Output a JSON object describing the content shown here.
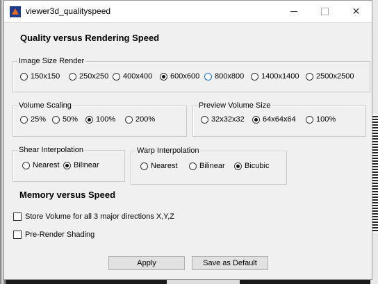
{
  "window": {
    "title": "viewer3d_qualityspeed"
  },
  "sections": {
    "quality_title": "Quality versus Rendering Speed",
    "memory_title": "Memory versus Speed"
  },
  "image_size": {
    "legend": "Image Size Render",
    "options": [
      "150x150",
      "250x250",
      "400x400",
      "600x600",
      "800x800",
      "1400x1400",
      "2500x2500"
    ],
    "selected": "600x600"
  },
  "volume_scaling": {
    "legend": "Volume Scaling",
    "options": [
      "25%",
      "50%",
      "100%",
      "200%"
    ],
    "selected": "100%"
  },
  "preview_volume_size": {
    "legend": "Preview Volume Size",
    "options": [
      "32x32x32",
      "64x64x64",
      "100%"
    ],
    "selected": "64x64x64"
  },
  "shear_interpolation": {
    "legend": "Shear Interpolation",
    "options": [
      "Nearest",
      "Bilinear"
    ],
    "selected": "Bilinear"
  },
  "warp_interpolation": {
    "legend": "Warp Interpolation",
    "options": [
      "Nearest",
      "Bilinear",
      "Bicubic"
    ],
    "selected": "Bicubic"
  },
  "memory": {
    "store_volume_label": "Store Volume for all 3 major directions X,Y,Z",
    "store_volume_checked": false,
    "prerender_label": "Pre-Render Shading",
    "prerender_checked": false
  },
  "buttons": {
    "apply": "Apply",
    "save_default": "Save as Default"
  }
}
